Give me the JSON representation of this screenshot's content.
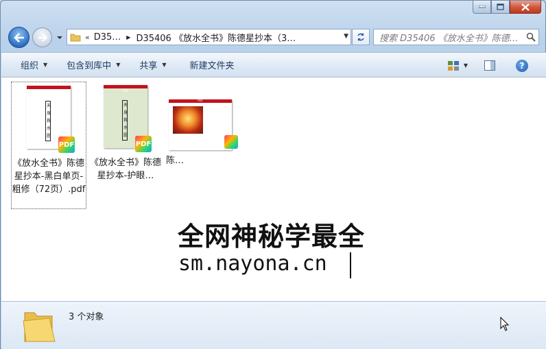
{
  "address": {
    "overflow": "«",
    "crumbs": [
      "D35…",
      "D35406 《放水全书》陈德星抄本（3…"
    ]
  },
  "search": {
    "placeholder": "搜索 D35406 《放水全书》陈德…"
  },
  "toolbar": {
    "organize": "组织",
    "include_library": "包含到库中",
    "share": "共享",
    "new_folder": "新建文件夹"
  },
  "files": [
    {
      "name": "《放水全书》陈德星抄本-黑白单页-粗修（72页）.pdf",
      "selected": true,
      "thumb_text": "天 身 救 水 圖",
      "badge": "PDF"
    },
    {
      "name": "《放水全书》陈德星抄本-护眼…",
      "selected": false,
      "thumb_text": "天 身 救 水 圖",
      "badge": "PDF"
    },
    {
      "name": "陈…",
      "selected": false,
      "badge": "PDF"
    }
  ],
  "watermark": {
    "title": "全网神秘学最全",
    "url": "sm.nayona.cn"
  },
  "details": {
    "count": "3 个对象"
  },
  "colors": {
    "accent": "#1c58b0",
    "pdf_bar": "#c3121d"
  }
}
